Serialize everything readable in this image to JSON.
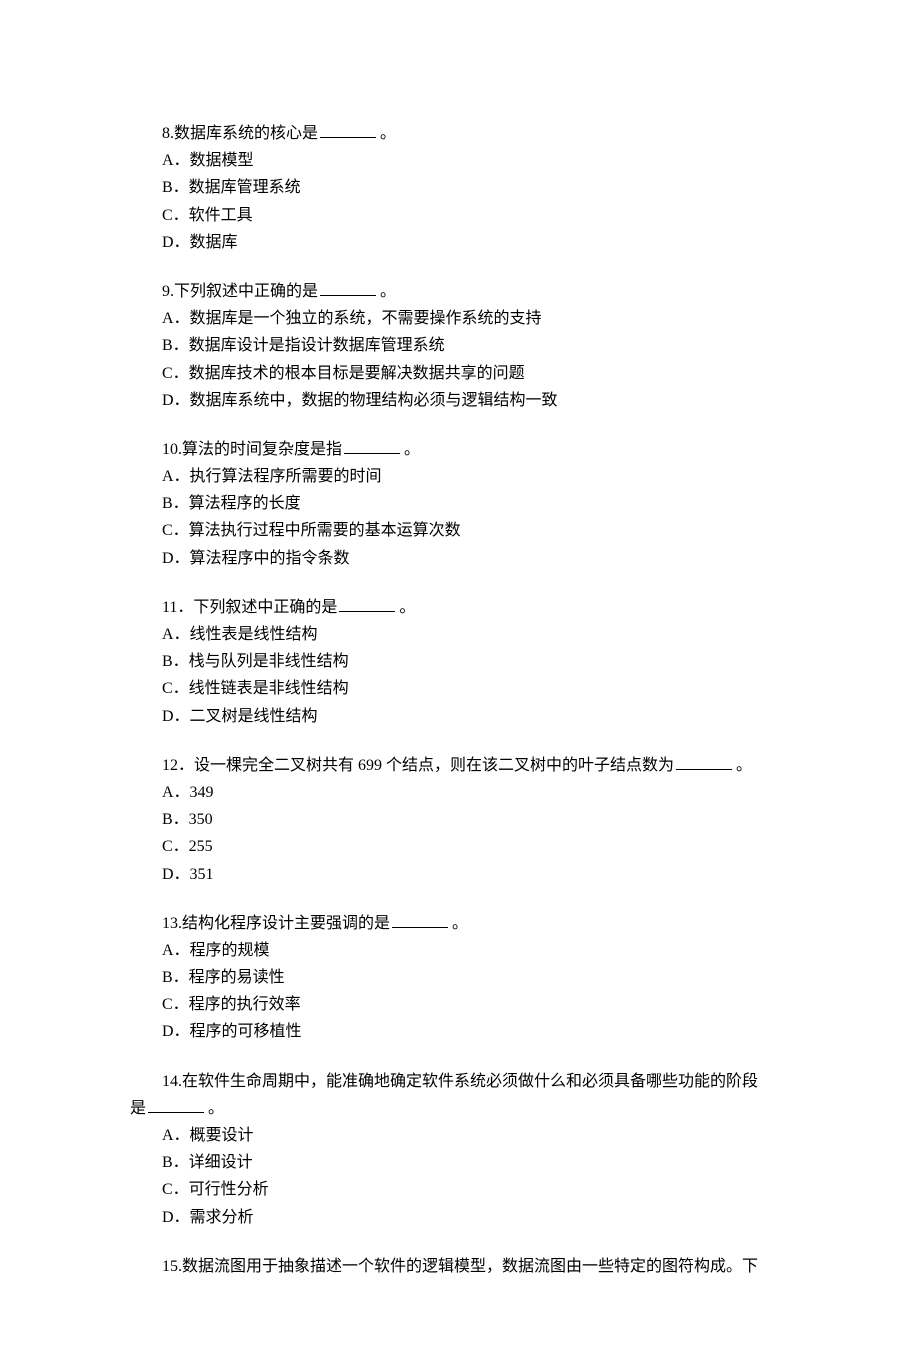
{
  "questions": [
    {
      "number": "8",
      "prompt_before": ".数据库系统的核心是",
      "prompt_after": "。",
      "options": [
        "A．数据模型",
        "B．数据库管理系统",
        "C．软件工具",
        "D．数据库"
      ]
    },
    {
      "number": "9",
      "prompt_before": ".下列叙述中正确的是",
      "prompt_after": "。",
      "options": [
        "A．数据库是一个独立的系统，不需要操作系统的支持",
        "B．数据库设计是指设计数据库管理系统",
        "C．数据库技术的根本目标是要解决数据共享的问题",
        "D．数据库系统中，数据的物理结构必须与逻辑结构一致"
      ]
    },
    {
      "number": "10",
      "prompt_before": ".算法的时间复杂度是指",
      "prompt_after": "。",
      "options": [
        "A．执行算法程序所需要的时间",
        "B．算法程序的长度",
        "C．算法执行过程中所需要的基本运算次数",
        "D．算法程序中的指令条数"
      ]
    },
    {
      "number": "11",
      "prompt_before": "．下列叙述中正确的是",
      "prompt_after": "。",
      "options": [
        "A．线性表是线性结构",
        "B．栈与队列是非线性结构",
        "C．线性链表是非线性结构",
        "D．二叉树是线性结构"
      ]
    },
    {
      "number": "12",
      "prompt_before": "．设一棵完全二叉树共有 699 个结点，则在该二叉树中的叶子结点数为",
      "prompt_after": "。",
      "options": [
        "A．349",
        "B．350",
        "C．255",
        "D．351"
      ]
    },
    {
      "number": "13",
      "prompt_before": ".结构化程序设计主要强调的是",
      "prompt_after": "。",
      "options": [
        "A．程序的规模",
        "B．程序的易读性",
        "C．程序的执行效率",
        "D．程序的可移植性"
      ]
    },
    {
      "number": "14",
      "prompt_line1": ".在软件生命周期中，能准确地确定软件系统必须做什么和必须具备哪些功能的阶段",
      "prompt_line2_before": "是",
      "prompt_after": "。",
      "options": [
        "A．概要设计",
        "B．详细设计",
        "C．可行性分析",
        "D．需求分析"
      ]
    },
    {
      "number": "15",
      "prompt_before": ".数据流图用于抽象描述一个软件的逻辑模型，数据流图由一些特定的图符构成。下",
      "options": []
    }
  ]
}
